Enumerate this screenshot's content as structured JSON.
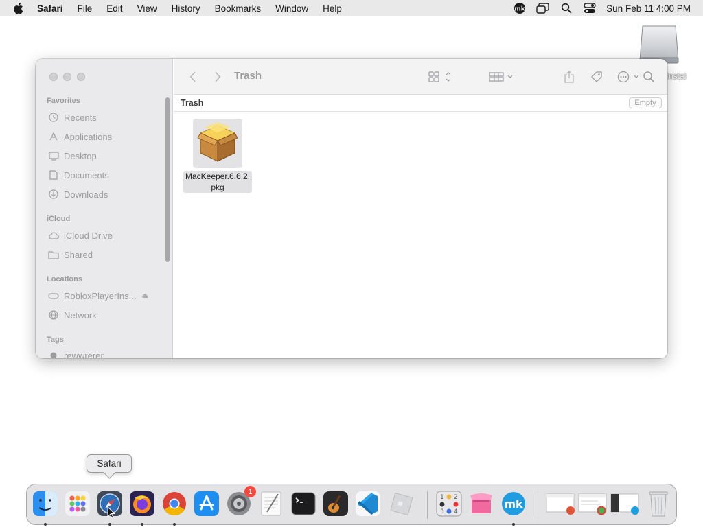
{
  "menubar": {
    "app_name": "Safari",
    "items": [
      "File",
      "Edit",
      "View",
      "History",
      "Bookmarks",
      "Window",
      "Help"
    ],
    "clock": "Sun Feb 11  4:00 PM",
    "status_icons": [
      "mackeeper-icon",
      "screen-mirroring-icon",
      "spotlight-search-icon",
      "control-center-icon"
    ]
  },
  "desktop": {
    "drive_label": "erInstal"
  },
  "finder": {
    "toolbar_title": "Trash",
    "path_title": "Trash",
    "empty_button": "Empty",
    "sidebar": {
      "favorites_header": "Favorites",
      "favorites": [
        {
          "label": "Recents",
          "icon": "clock-icon"
        },
        {
          "label": "Applications",
          "icon": "applications-icon"
        },
        {
          "label": "Desktop",
          "icon": "desktop-icon"
        },
        {
          "label": "Documents",
          "icon": "document-icon"
        },
        {
          "label": "Downloads",
          "icon": "download-icon"
        }
      ],
      "icloud_header": "iCloud",
      "icloud": [
        {
          "label": "iCloud Drive",
          "icon": "cloud-icon"
        },
        {
          "label": "Shared",
          "icon": "shared-folder-icon"
        }
      ],
      "locations_header": "Locations",
      "locations": [
        {
          "label": "RobloxPlayerIns...",
          "icon": "drive-icon"
        },
        {
          "label": "Network",
          "icon": "globe-icon"
        }
      ],
      "tags_header": "Tags",
      "tags": [
        {
          "label": "rewwrerer",
          "color": "#9c9c9e"
        }
      ]
    },
    "files": [
      {
        "name_line1": "MacKeeper.6.6.2.",
        "name_line2": "pkg",
        "icon": "package-icon"
      }
    ]
  },
  "dock": {
    "tooltip": "Safari",
    "settings_badge": "1",
    "apps": [
      "finder-icon",
      "launchpad-icon",
      "safari-icon",
      "firefox-icon",
      "chrome-icon",
      "app-store-icon",
      "system-settings-icon",
      "textedit-icon",
      "terminal-icon",
      "garageband-icon",
      "vscode-icon",
      "roblox-icon",
      "sudoku-icon",
      "cleanmymac-icon",
      "mackeeper-icon",
      "window-thumbnail-icon",
      "window-thumbnail-icon",
      "window-thumbnail-icon",
      "trash-icon"
    ]
  }
}
